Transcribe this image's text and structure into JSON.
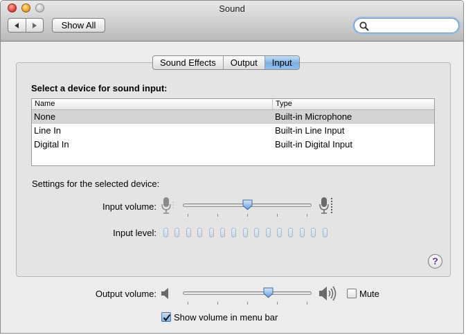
{
  "window": {
    "title": "Sound"
  },
  "toolbar": {
    "back_icon": "back-arrow-icon",
    "forward_icon": "forward-arrow-icon",
    "show_all_label": "Show All"
  },
  "search": {
    "value": "",
    "placeholder": ""
  },
  "tabs": [
    {
      "label": "Sound Effects",
      "active": false
    },
    {
      "label": "Output",
      "active": false
    },
    {
      "label": "Input",
      "active": true
    }
  ],
  "input_pane": {
    "heading": "Select a device for sound input:",
    "columns": {
      "name": "Name",
      "type": "Type"
    },
    "devices": [
      {
        "name": "None",
        "type": "Built-in Microphone",
        "selected": true
      },
      {
        "name": "Line In",
        "type": "Built-in Line Input",
        "selected": false
      },
      {
        "name": "Digital In",
        "type": "Built-in Digital Input",
        "selected": false
      }
    ],
    "settings_heading": "Settings for the selected device:",
    "input_volume_label": "Input volume:",
    "input_volume_level": 0.5,
    "input_level_label": "Input level:",
    "input_level_segments": 15,
    "input_level_active": 0,
    "help_label": "?"
  },
  "footer": {
    "output_volume_label": "Output volume:",
    "output_volume_level": 0.68,
    "mute_label": "Mute",
    "mute_checked": false,
    "menu_bar_label": "Show volume in menu bar",
    "menu_bar_checked": true
  },
  "colors": {
    "selection_gray": "#d4d4d4",
    "tab_active_blue": "#7aaee4",
    "focus_ring": "#9cc0e8"
  }
}
